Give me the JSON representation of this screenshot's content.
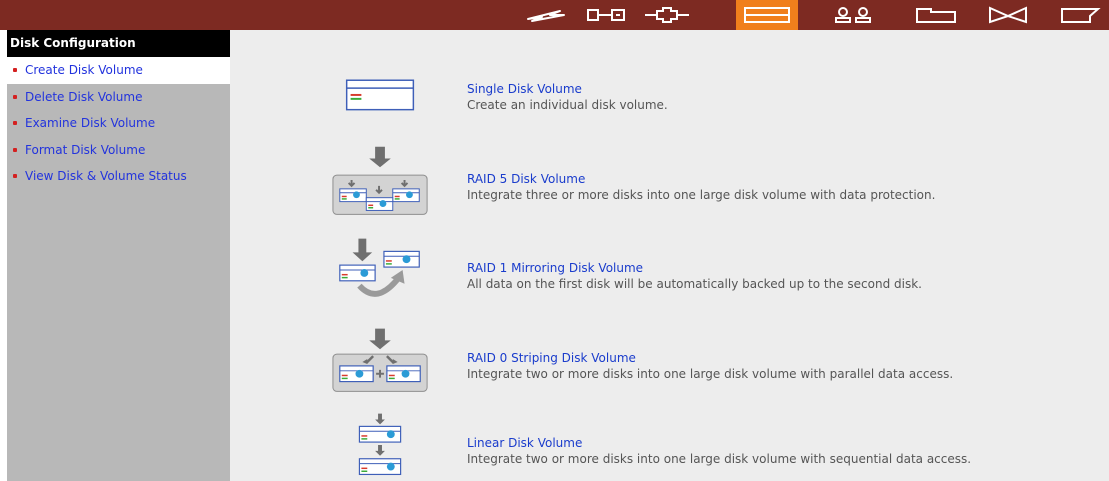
{
  "topbar": {
    "icons": [
      {
        "name": "quick-config-icon"
      },
      {
        "name": "system-settings-icon"
      },
      {
        "name": "network-settings-icon"
      },
      {
        "name": "disk-configuration-icon",
        "active": true
      },
      {
        "name": "user-management-icon"
      },
      {
        "name": "network-share-icon"
      },
      {
        "name": "system-tools-icon"
      },
      {
        "name": "statistics-logs-icon"
      }
    ],
    "active_color": "#f07f1c",
    "bar_color": "#7d2a22"
  },
  "sidebar": {
    "title": "Disk Configuration",
    "items": [
      {
        "label": "Create Disk Volume",
        "selected": true
      },
      {
        "label": "Delete Disk Volume"
      },
      {
        "label": "Examine Disk Volume"
      },
      {
        "label": "Format Disk Volume"
      },
      {
        "label": "View Disk & Volume Status"
      }
    ]
  },
  "main": {
    "options": [
      {
        "title": "Single Disk Volume",
        "description": "Create an individual disk volume.",
        "icon": "single-disk-icon"
      },
      {
        "title": "RAID 5 Disk Volume",
        "description": "Integrate three or more disks into one large disk volume with data protection.",
        "icon": "raid5-icon"
      },
      {
        "title": "RAID 1 Mirroring Disk Volume",
        "description": "All data on the first disk will be automatically backed up to the second disk.",
        "icon": "raid1-icon"
      },
      {
        "title": "RAID 0 Striping Disk Volume",
        "description": "Integrate two or more disks into one large disk volume with parallel data access.",
        "icon": "raid0-icon"
      },
      {
        "title": "Linear Disk Volume",
        "description": "Integrate two or more disks into one large disk volume with sequential data access.",
        "icon": "linear-disk-icon"
      }
    ]
  }
}
